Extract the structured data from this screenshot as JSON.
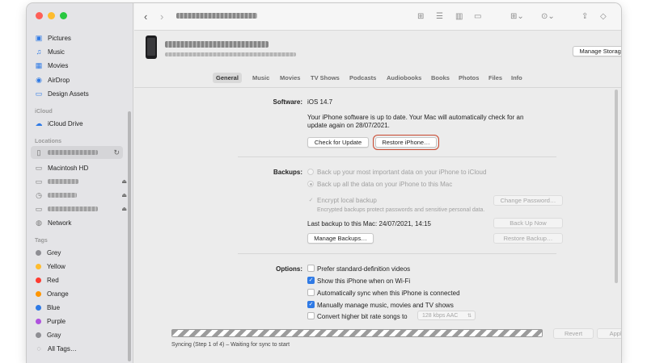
{
  "sidebar": {
    "favorites": [
      {
        "icon": "pictures-icon",
        "label": "Pictures"
      },
      {
        "icon": "music-icon",
        "label": "Music"
      },
      {
        "icon": "movies-icon",
        "label": "Movies"
      },
      {
        "icon": "airdrop-icon",
        "label": "AirDrop"
      },
      {
        "icon": "folder-icon",
        "label": "Design Assets"
      }
    ],
    "icloud_heading": "iCloud",
    "icloud_drive": "iCloud Drive",
    "locations_heading": "Locations",
    "macintosh_hd": "Macintosh HD",
    "network": "Network",
    "tags_heading": "Tags",
    "tags": [
      {
        "label": "Grey",
        "color": "#8e8e93"
      },
      {
        "label": "Yellow",
        "color": "#febc2e"
      },
      {
        "label": "Red",
        "color": "#fe3b30"
      },
      {
        "label": "Orange",
        "color": "#ff9500"
      },
      {
        "label": "Blue",
        "color": "#2f7ae5"
      },
      {
        "label": "Purple",
        "color": "#af52de"
      },
      {
        "label": "Gray",
        "color": "#8e8e93"
      }
    ],
    "all_tags": "All Tags…"
  },
  "device": {
    "manage_storage": "Manage Storage…"
  },
  "tabs": [
    "General",
    "Music",
    "Movies",
    "TV Shows",
    "Podcasts",
    "Audiobooks",
    "Books",
    "Photos",
    "Files",
    "Info"
  ],
  "software": {
    "label": "Software:",
    "version": "iOS 14.7",
    "status_line1": "Your iPhone software is up to date. Your Mac will automatically check for an",
    "status_line2": "update again on 28/07/2021.",
    "check_update": "Check for Update",
    "restore": "Restore iPhone…"
  },
  "backups": {
    "label": "Backups:",
    "opt_icloud": "Back up your most important data on your iPhone to iCloud",
    "opt_mac": "Back up all the data on your iPhone to this Mac",
    "encrypt": "Encrypt local backup",
    "change_password": "Change Password…",
    "encrypt_note": "Encrypted backups protect passwords and sensitive personal data.",
    "last_backup": "Last backup to this Mac: 24/07/2021, 14:15",
    "back_up_now": "Back Up Now",
    "manage_backups": "Manage Backups…",
    "restore_backup": "Restore Backup…"
  },
  "options": {
    "label": "Options:",
    "items": [
      {
        "label": "Prefer standard-definition videos",
        "checked": false
      },
      {
        "label": "Show this iPhone when on Wi-Fi",
        "checked": true
      },
      {
        "label": "Automatically sync when this iPhone is connected",
        "checked": false
      },
      {
        "label": "Manually manage music, movies and TV shows",
        "checked": true
      },
      {
        "label": "Convert higher bit rate songs to",
        "checked": false
      }
    ],
    "bitrate": "128 kbps AAC"
  },
  "footer": {
    "revert": "Revert",
    "apply": "Apply",
    "status": "Syncing (Step 1 of 4) – Waiting for sync to start"
  }
}
